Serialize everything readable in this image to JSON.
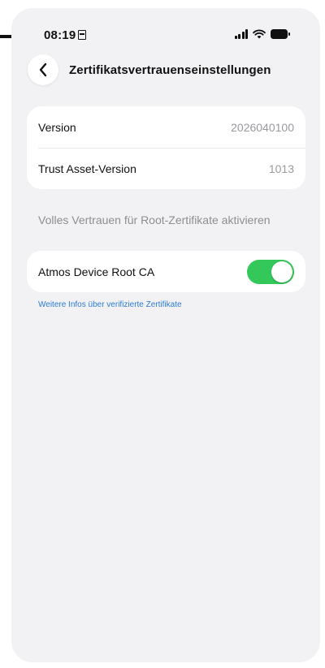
{
  "status_bar": {
    "time": "08:19"
  },
  "nav": {
    "title": "Zertifikatsvertrauenseinstellungen"
  },
  "info_rows": [
    {
      "label": "Version",
      "value": "2026040100"
    },
    {
      "label": "Trust Asset-Version",
      "value": "1013"
    }
  ],
  "trust_section": {
    "header": "Volles Vertrauen für Root-Zertifikate aktivieren",
    "certificates": [
      {
        "label": "Atmos Device Root CA",
        "enabled": true
      }
    ],
    "link": "Weitere Infos über verifizierte Zertifikate"
  },
  "colors": {
    "accent": "#34c759",
    "link": "#2f7bd8",
    "background": "#f2f2f4"
  }
}
